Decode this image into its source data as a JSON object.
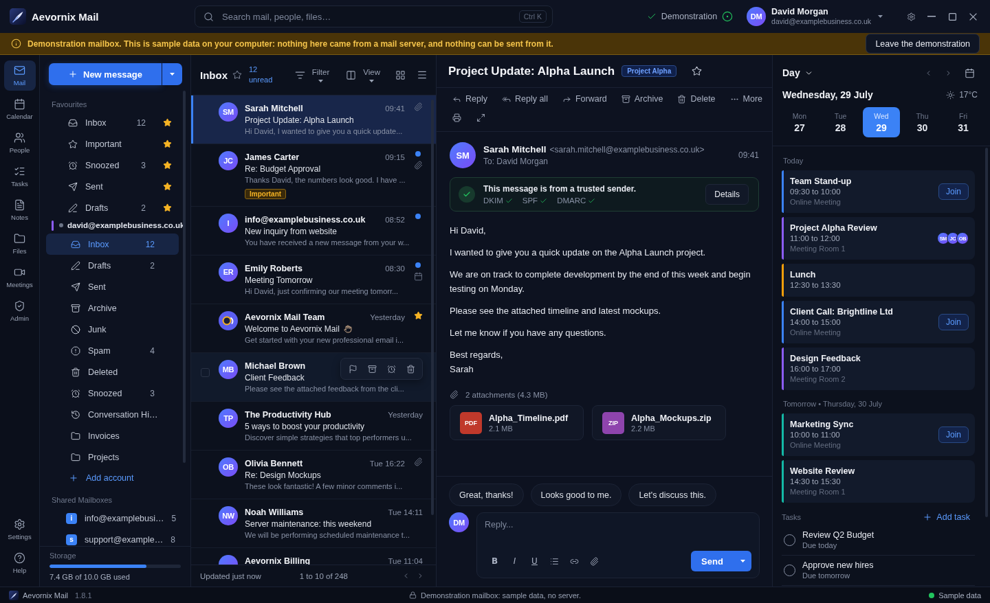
{
  "window": {
    "app_name": "Aevornix Mail",
    "search": {
      "placeholder": "Search mail, people, files…",
      "shortcut": "Ctrl K"
    },
    "status": {
      "label": "Demonstration",
      "connected": true
    },
    "user": {
      "initials": "DM",
      "name": "David Morgan",
      "email": "david@examplebusiness.co.uk"
    }
  },
  "banner": {
    "text": "Demonstration mailbox. This is sample data on your computer: nothing here came from a mail server, and nothing can be sent from it.",
    "button": "Leave the demonstration"
  },
  "nav_rail": {
    "items": [
      {
        "kind": "mail",
        "label": "Mail",
        "selected": true
      },
      {
        "kind": "calendar",
        "label": "Calendar",
        "selected": false
      },
      {
        "kind": "people",
        "label": "People",
        "selected": false
      },
      {
        "kind": "tasks",
        "label": "Tasks",
        "selected": false
      },
      {
        "kind": "notes",
        "label": "Notes",
        "selected": false
      },
      {
        "kind": "files",
        "label": "Files",
        "selected": false
      },
      {
        "kind": "meetings",
        "label": "Meetings",
        "selected": false
      },
      {
        "kind": "admin",
        "label": "Admin",
        "selected": false
      }
    ],
    "bottom_items": [
      {
        "kind": "settings",
        "label": "Settings",
        "selected": false
      },
      {
        "kind": "help",
        "label": "Help",
        "selected": false
      }
    ]
  },
  "folders": {
    "new_message": "New message",
    "favourites": {
      "title": "Favourites",
      "items": [
        {
          "kind": "inbox",
          "label": "Inbox",
          "count": "12",
          "starred": true,
          "selected": false
        },
        {
          "kind": "important",
          "label": "Important",
          "starred": true,
          "selected": false
        },
        {
          "kind": "snoozed",
          "label": "Snoozed",
          "count": "3",
          "starred": true,
          "selected": false
        },
        {
          "kind": "sent",
          "label": "Sent",
          "starred": true,
          "selected": false
        },
        {
          "kind": "drafts",
          "label": "Drafts",
          "count": "2",
          "starred": true,
          "selected": false
        }
      ]
    },
    "account": {
      "email": "david@examplebusiness.co.uk",
      "items": [
        {
          "kind": "inbox",
          "label": "Inbox",
          "count": "12",
          "selected": true
        },
        {
          "kind": "drafts",
          "label": "Drafts",
          "count": "2",
          "selected": false
        },
        {
          "kind": "sent",
          "label": "Sent",
          "selected": false
        },
        {
          "kind": "archive",
          "label": "Archive",
          "selected": false
        },
        {
          "kind": "junk",
          "label": "Junk",
          "selected": false
        },
        {
          "kind": "spam",
          "label": "Spam",
          "count": "4",
          "selected": false
        },
        {
          "kind": "deleted",
          "label": "Deleted",
          "selected": false
        },
        {
          "kind": "snoozed",
          "label": "Snoozed",
          "count": "3",
          "selected": false
        },
        {
          "kind": "history",
          "label": "Conversation Hi…",
          "selected": false
        },
        {
          "kind": "folder",
          "label": "Invoices",
          "selected": false
        },
        {
          "kind": "folder",
          "label": "Projects",
          "selected": false
        }
      ]
    },
    "add_account": "Add account",
    "shared": {
      "title": "Shared Mailboxes",
      "items": [
        {
          "badge": "i",
          "label": "info@examplebusi…",
          "count": "5",
          "selected": false
        },
        {
          "badge": "s",
          "label": "support@example…",
          "count": "8",
          "selected": false
        }
      ]
    },
    "storage": {
      "title": "Storage",
      "level": 0.74,
      "usage": "7.4 GB of 10.0 GB used"
    }
  },
  "message_list": {
    "title": "Inbox",
    "unread": "12 unread",
    "filter": "Filter",
    "view": "View",
    "messages": [
      {
        "avatar": {
          "kind": "initials",
          "text": "SM"
        },
        "sender": "Sarah Mitchell",
        "time": "09:41",
        "subject": "Project Update: Alpha Launch",
        "preview": "Hi David, I wanted to give you a quick update...",
        "selected": true,
        "unread": false,
        "attachment": true
      },
      {
        "avatar": {
          "kind": "initials",
          "text": "JC"
        },
        "sender": "James Carter",
        "time": "09:15",
        "subject": "Re: Budget Approval",
        "preview": "Thanks David, the numbers look good. I have ...",
        "tag": "Important",
        "selected": false,
        "unread": true,
        "attachment": true
      },
      {
        "avatar": {
          "kind": "initials",
          "text": "I"
        },
        "sender": "info@examplebusiness.co.uk",
        "time": "08:52",
        "subject": "New inquiry from website",
        "preview": "You have received a new message from your w...",
        "selected": false,
        "unread": true
      },
      {
        "avatar": {
          "kind": "initials",
          "text": "ER"
        },
        "sender": "Emily Roberts",
        "time": "08:30",
        "subject": "Meeting Tomorrow",
        "preview": "Hi David, just confirming our meeting tomorr...",
        "selected": false,
        "unread": true,
        "invite": true
      },
      {
        "avatar": {
          "kind": "logo"
        },
        "sender": "Aevornix Mail Team",
        "time": "Yesterday",
        "subject": "Welcome to Aevornix Mail",
        "wave_emoji": true,
        "preview": "Get started with your new professional email i...",
        "selected": false,
        "unread": false,
        "starred": true
      },
      {
        "avatar": {
          "kind": "initials",
          "text": "MB"
        },
        "sender": "Michael Brown",
        "subject": "Client Feedback",
        "preview": "Please see the attached feedback from the cli...",
        "selected": false,
        "hovered": true,
        "unread": false
      },
      {
        "avatar": {
          "kind": "initials",
          "text": "TP"
        },
        "sender": "The Productivity Hub",
        "time": "Yesterday",
        "subject": "5 ways to boost your productivity",
        "preview": "Discover simple strategies that top performers u...",
        "selected": false,
        "unread": false
      },
      {
        "avatar": {
          "kind": "initials",
          "text": "OB"
        },
        "sender": "Olivia Bennett",
        "time": "Tue 16:22",
        "subject": "Re: Design Mockups",
        "preview": "These look fantastic! A few minor comments i...",
        "selected": false,
        "unread": false,
        "attachment": true
      },
      {
        "avatar": {
          "kind": "initials",
          "text": "NW"
        },
        "sender": "Noah Williams",
        "time": "Tue 14:11",
        "subject": "Server maintenance: this weekend",
        "preview": "We will be performing scheduled maintenance t...",
        "selected": false,
        "unread": false
      },
      {
        "avatar": {
          "kind": "plain"
        },
        "sender": "Aevornix Billing",
        "time": "Tue 11:04",
        "selected": false,
        "unread": false
      }
    ],
    "footer": {
      "updated": "Updated just now",
      "range": "1 to 10 of 248"
    }
  },
  "reading_pane": {
    "subject": "Project Update: Alpha Launch",
    "label": "Project Alpha",
    "starred": false,
    "actions": [
      {
        "kind": "reply",
        "label": "Reply"
      },
      {
        "kind": "reply_all",
        "label": "Reply all"
      },
      {
        "kind": "forward",
        "label": "Forward"
      },
      {
        "kind": "archive",
        "label": "Archive"
      },
      {
        "kind": "delete",
        "label": "Delete"
      },
      {
        "kind": "more",
        "label": "More"
      },
      {
        "kind": "print"
      },
      {
        "kind": "expand"
      }
    ],
    "sender": {
      "initials": "SM",
      "name": "Sarah Mitchell",
      "email": "<sarah.mitchell@examplebusiness.co.uk>",
      "to": "To: David Morgan",
      "time": "09:41"
    },
    "trust": {
      "title": "This message is from a trusted sender.",
      "checks": [
        {
          "label": "DKIM",
          "passed": true
        },
        {
          "label": "SPF",
          "passed": true
        },
        {
          "label": "DMARC",
          "passed": true
        }
      ],
      "button": "Details"
    },
    "body": [
      "Hi David,",
      "I wanted to give you a quick update on the Alpha Launch project.",
      "We are on track to complete development by the end of this week and begin testing on Monday.",
      "Please see the attached timeline and latest mockups.",
      "Let me know if you have any questions.",
      "Best regards,\nSarah"
    ],
    "attachments": {
      "summary": "2 attachments (4.3 MB)",
      "files": [
        {
          "kind": "pdf",
          "badge": "PDF",
          "name": "Alpha_Timeline.pdf",
          "size": "2.1 MB"
        },
        {
          "kind": "zip",
          "badge": "ZIP",
          "name": "Alpha_Mockups.zip",
          "size": "2.2 MB"
        }
      ]
    },
    "quick_replies": [
      "Great, thanks!",
      "Looks good to me.",
      "Let's discuss this."
    ],
    "composer": {
      "initials": "DM",
      "placeholder": "Reply...",
      "format_buttons": [
        {
          "kind": "bold",
          "label": "B"
        },
        {
          "kind": "italic",
          "label": "I"
        },
        {
          "kind": "underline",
          "label": "U"
        },
        {
          "kind": "list"
        },
        {
          "kind": "link"
        },
        {
          "kind": "attach"
        }
      ],
      "send": "Send"
    }
  },
  "calendar": {
    "view": "Day",
    "date": "Wednesday, 29 July",
    "weather": "17°C",
    "days": [
      {
        "dow": "Mon",
        "date": "27",
        "selected": false
      },
      {
        "dow": "Tue",
        "date": "28",
        "selected": false
      },
      {
        "dow": "Wed",
        "date": "29",
        "selected": true
      },
      {
        "dow": "Thu",
        "date": "30",
        "selected": false
      },
      {
        "dow": "Fri",
        "date": "31",
        "selected": false
      }
    ],
    "sections": [
      {
        "title": "Today",
        "events": [
          {
            "title": "Team Stand-up",
            "time": "09:30 to 10:00",
            "location": "Online Meeting",
            "color": "#3b82f6",
            "action": "Join"
          },
          {
            "title": "Project Alpha Review",
            "time": "11:00 to 12:00",
            "location": "Meeting Room 1",
            "color": "#8b5cf6",
            "attendees": [
              "SM",
              "JC",
              "OB"
            ]
          },
          {
            "title": "Lunch",
            "time": "12:30 to 13:30",
            "color": "#f59e0b"
          },
          {
            "title": "Client Call: Brightline Ltd",
            "time": "14:00 to 15:00",
            "location": "Online Meeting",
            "color": "#3b82f6",
            "action": "Join"
          },
          {
            "title": "Design Feedback",
            "time": "16:00 to 17:00",
            "location": "Meeting Room 2",
            "color": "#8b5cf6"
          }
        ]
      },
      {
        "title": "Tomorrow • Thursday, 30 July",
        "events": [
          {
            "title": "Marketing Sync",
            "time": "10:00 to 11:00",
            "location": "Online Meeting",
            "color": "#14b8a6",
            "action": "Join"
          },
          {
            "title": "Website Review",
            "time": "14:30 to 15:30",
            "location": "Meeting Room 1",
            "color": "#14b8a6"
          }
        ]
      }
    ],
    "tasks": {
      "title": "Tasks",
      "add": "Add task",
      "items": [
        {
          "title": "Review Q2 Budget",
          "due": "Due today",
          "done": false
        },
        {
          "title": "Approve new hires",
          "due": "Due tomorrow",
          "done": false
        }
      ]
    }
  },
  "status_bar": {
    "app": "Aevornix Mail",
    "version": "1.8.1",
    "notice": "Demonstration mailbox: sample data, no server.",
    "mode": "Sample data"
  }
}
